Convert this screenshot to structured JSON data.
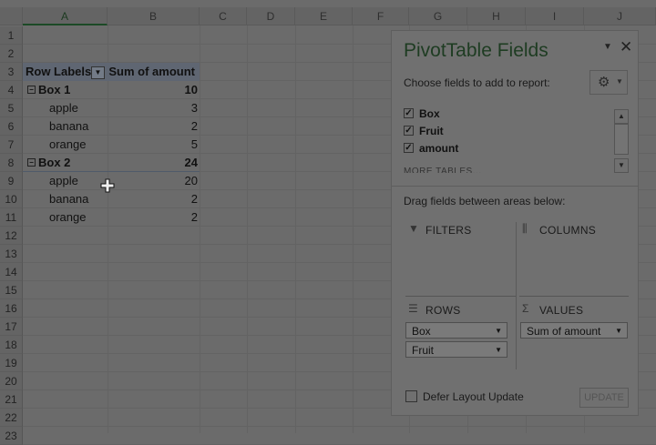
{
  "columns": [
    "A",
    "B",
    "C",
    "D",
    "E",
    "F",
    "G",
    "H",
    "I",
    "J"
  ],
  "rows": [
    "1",
    "2",
    "3",
    "4",
    "5",
    "6",
    "7",
    "8",
    "9",
    "10",
    "11",
    "12",
    "13",
    "14",
    "15",
    "16",
    "17",
    "18",
    "19",
    "20",
    "21",
    "22",
    "23"
  ],
  "pivot": {
    "header_labels": "Row Labels",
    "header_sum": "Sum of amount",
    "groups": [
      {
        "label": "Box 1",
        "total": "10",
        "items": [
          {
            "name": "apple",
            "value": "3"
          },
          {
            "name": "banana",
            "value": "2"
          },
          {
            "name": "orange",
            "value": "5"
          }
        ]
      },
      {
        "label": "Box 2",
        "total": "24",
        "items": [
          {
            "name": "apple",
            "value": "20"
          },
          {
            "name": "banana",
            "value": "2"
          },
          {
            "name": "orange",
            "value": "2"
          }
        ]
      }
    ]
  },
  "panel": {
    "title": "PivotTable Fields",
    "choose_label": "Choose fields to add to report:",
    "fields": [
      {
        "label": "Box",
        "checked": true
      },
      {
        "label": "Fruit",
        "checked": true
      },
      {
        "label": "amount",
        "checked": true
      }
    ],
    "more_tables": "MORE TABLES...",
    "drag_label": "Drag fields between areas below:",
    "areas": {
      "filters": "FILTERS",
      "columns": "COLUMNS",
      "rows": "ROWS",
      "values": "VALUES"
    },
    "rows_items": [
      "Box",
      "Fruit"
    ],
    "values_items": [
      "Sum of amount"
    ],
    "defer_label": "Defer Layout Update",
    "update_label": "UPDATE"
  }
}
